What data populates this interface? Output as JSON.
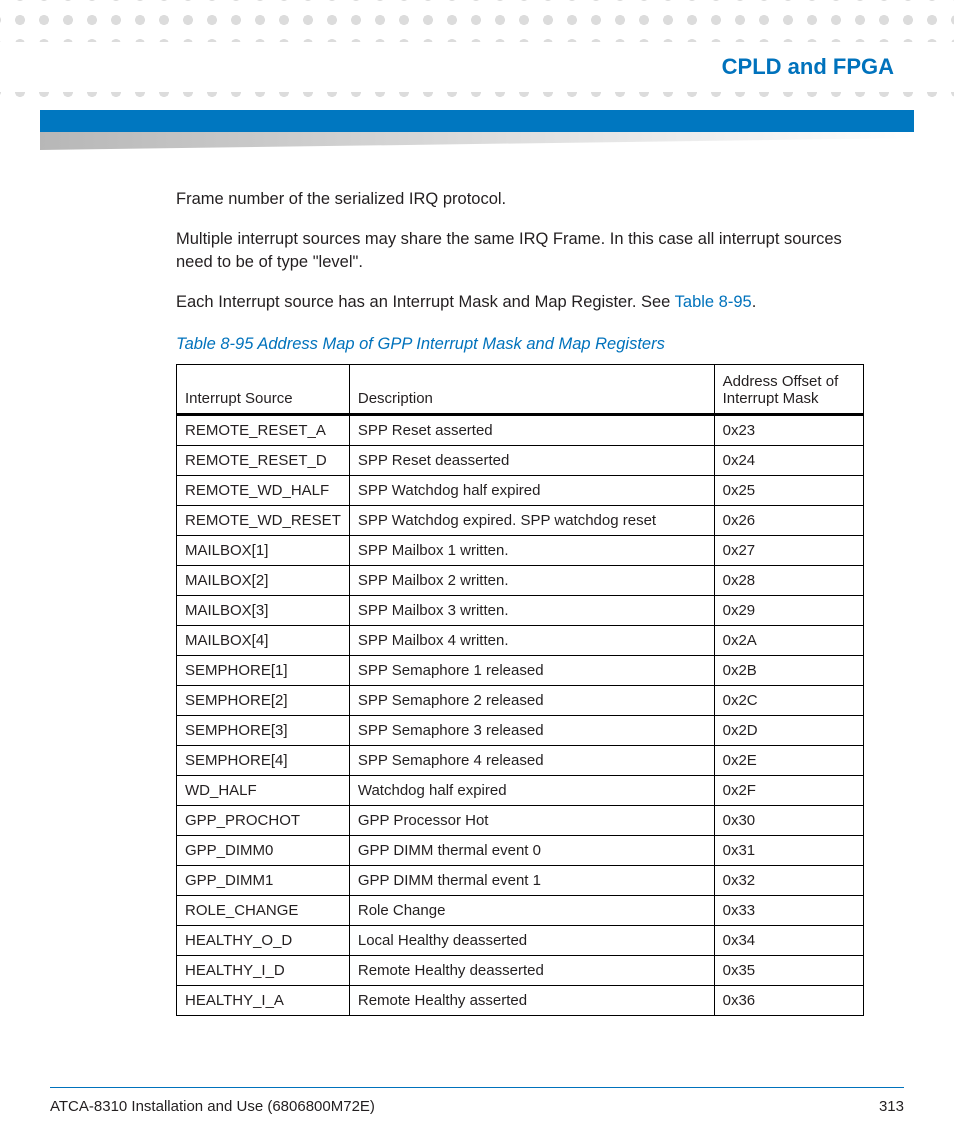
{
  "header": {
    "chapter_title": "CPLD and FPGA"
  },
  "body": {
    "para1": "Frame number of the serialized IRQ protocol.",
    "para2": "Multiple interrupt sources may share the same IRQ Frame. In this case all interrupt sources need to be of type \"level\".",
    "para3_pre": "Each Interrupt source has an Interrupt Mask and Map Register. See ",
    "para3_link": "Table 8-95",
    "para3_post": "."
  },
  "table": {
    "caption": "Table 8-95 Address Map of GPP Interrupt Mask and Map Registers",
    "headers": {
      "col1": "Interrupt Source",
      "col2": "Description",
      "col3": "Address Offset of Interrupt Mask"
    },
    "rows": [
      {
        "src": "REMOTE_RESET_A",
        "desc": "SPP Reset asserted",
        "addr": "0x23"
      },
      {
        "src": "REMOTE_RESET_D",
        "desc": "SPP Reset deasserted",
        "addr": "0x24"
      },
      {
        "src": "REMOTE_WD_HALF",
        "desc": "SPP Watchdog half expired",
        "addr": "0x25"
      },
      {
        "src": "REMOTE_WD_RESET",
        "desc": "SPP Watchdog expired. SPP watchdog reset",
        "addr": "0x26"
      },
      {
        "src": "MAILBOX[1]",
        "desc": "SPP Mailbox 1 written.",
        "addr": "0x27"
      },
      {
        "src": "MAILBOX[2]",
        "desc": "SPP Mailbox 2 written.",
        "addr": "0x28"
      },
      {
        "src": "MAILBOX[3]",
        "desc": "SPP Mailbox 3 written.",
        "addr": "0x29"
      },
      {
        "src": "MAILBOX[4]",
        "desc": "SPP Mailbox 4 written.",
        "addr": "0x2A"
      },
      {
        "src": "SEMPHORE[1]",
        "desc": "SPP Semaphore 1 released",
        "addr": "0x2B"
      },
      {
        "src": "SEMPHORE[2]",
        "desc": "SPP Semaphore 2 released",
        "addr": "0x2C"
      },
      {
        "src": "SEMPHORE[3]",
        "desc": "SPP Semaphore 3 released",
        "addr": "0x2D"
      },
      {
        "src": "SEMPHORE[4]",
        "desc": "SPP Semaphore 4 released",
        "addr": "0x2E"
      },
      {
        "src": "WD_HALF",
        "desc": "Watchdog half expired",
        "addr": "0x2F"
      },
      {
        "src": "GPP_PROCHOT",
        "desc": "GPP Processor Hot",
        "addr": "0x30"
      },
      {
        "src": "GPP_DIMM0",
        "desc": "GPP DIMM thermal event 0",
        "addr": "0x31"
      },
      {
        "src": "GPP_DIMM1",
        "desc": "GPP DIMM thermal event 1",
        "addr": "0x32"
      },
      {
        "src": "ROLE_CHANGE",
        "desc": "Role Change",
        "addr": "0x33"
      },
      {
        "src": "HEALTHY_O_D",
        "desc": "Local Healthy deasserted",
        "addr": "0x34"
      },
      {
        "src": "HEALTHY_I_D",
        "desc": "Remote Healthy deasserted",
        "addr": "0x35"
      },
      {
        "src": "HEALTHY_I_A",
        "desc": "Remote Healthy asserted",
        "addr": "0x36"
      }
    ]
  },
  "footer": {
    "doc_title": "ATCA-8310 Installation and Use (6806800M72E)",
    "page_num": "313"
  }
}
